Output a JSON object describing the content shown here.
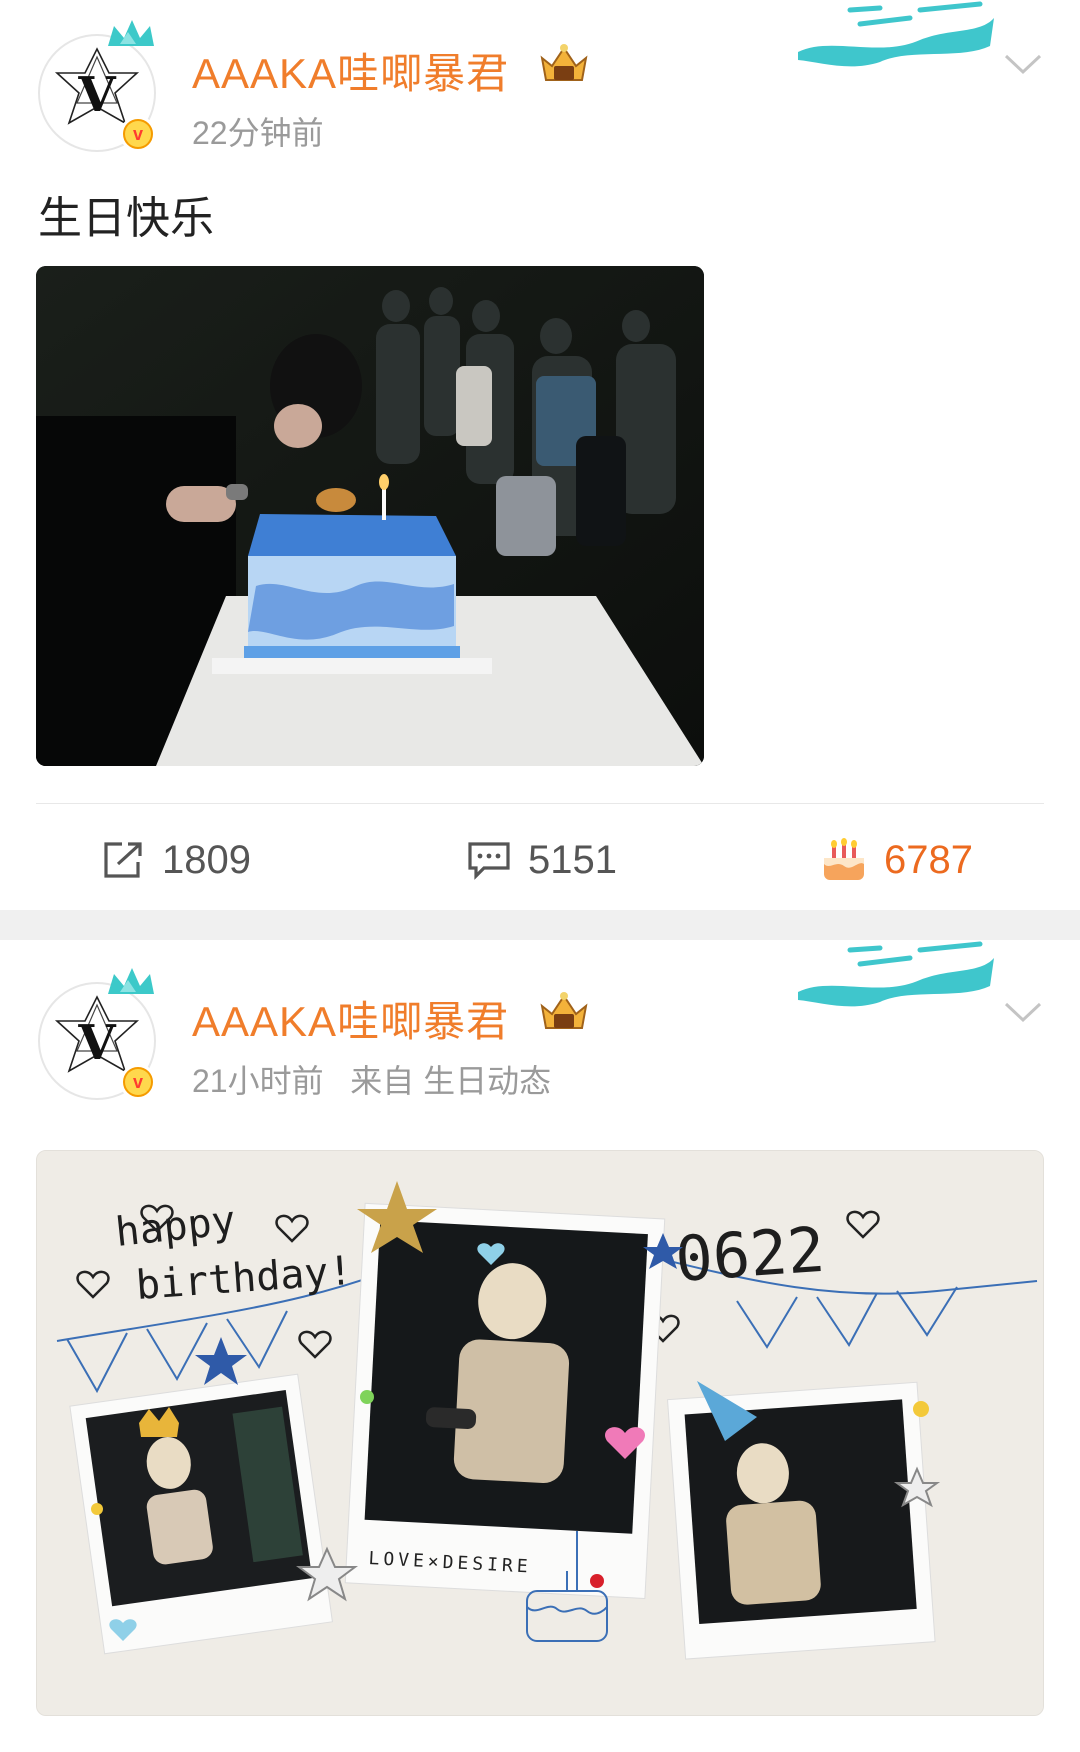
{
  "posts": [
    {
      "username": "AAAKA哇唧暴君",
      "timestamp": "22分钟前",
      "text": "生日快乐",
      "actions": {
        "repost_count": "1809",
        "comment_count": "5151",
        "like_count": "6787"
      }
    },
    {
      "username": "AAAKA哇唧暴君",
      "timestamp": "21小时前   来自 生日动态",
      "collage": {
        "happy_text": "happy",
        "birthday_text": "birthday!",
        "date_text": "0622",
        "caption_text": "LOVE×DESIRE"
      }
    }
  ],
  "colors": {
    "username": "#f07d2b",
    "like": "#ec6a1f",
    "muted": "#9a9a9a",
    "divider_band": "#f0f0f0"
  },
  "icons": [
    "avatar-v-logo-icon",
    "verified-badge-icon",
    "crown-badge-icon",
    "topic-sticker-icon",
    "chevron-down-icon",
    "repost-icon",
    "comment-icon",
    "cake-like-icon"
  ]
}
